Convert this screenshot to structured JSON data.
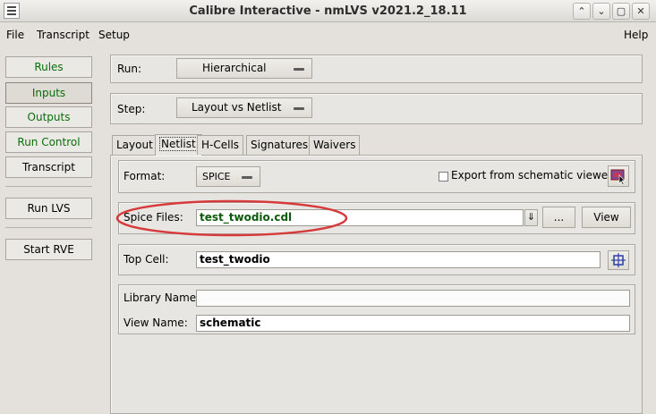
{
  "window": {
    "title": "Calibre Interactive - nmLVS v2021.2_18.11",
    "controls": [
      "⌃",
      "⌄",
      "▢",
      "✕"
    ]
  },
  "menubar": {
    "file": "File",
    "transcript": "Transcript",
    "setup": "Setup",
    "help": "Help"
  },
  "nav": {
    "rules": "Rules",
    "inputs": "Inputs",
    "outputs": "Outputs",
    "run_control": "Run Control",
    "transcript": "Transcript",
    "run_lvs": "Run LVS",
    "start_rve": "Start RVE"
  },
  "run": {
    "label": "Run:",
    "value": "Hierarchical"
  },
  "step": {
    "label": "Step:",
    "value": "Layout vs Netlist"
  },
  "tabs": [
    "Layout",
    "Netlist",
    "H-Cells",
    "Signatures",
    "Waivers"
  ],
  "netlist": {
    "format_label": "Format:",
    "format_value": "SPICE",
    "export_label": "Export from schematic viewer",
    "spice_label": "Spice Files:",
    "spice_value": "test_twodio.cdl",
    "browse_label": "...",
    "view_label": "View",
    "top_cell_label": "Top Cell:",
    "top_cell_value": "test_twodio",
    "library_label": "Library Name:",
    "library_value": "",
    "view_name_label": "View Name:",
    "view_name_value": "schematic"
  },
  "colors": {
    "annotation_red": "#d63a3a",
    "nav_green": "#0a6e0a",
    "spice_text": "#0b5a0b"
  }
}
